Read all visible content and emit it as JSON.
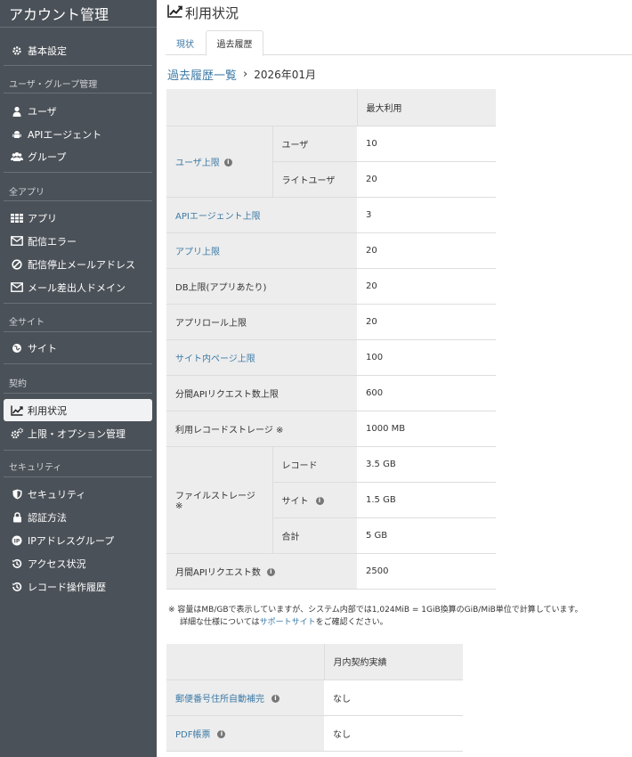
{
  "sidebar": {
    "title": "アカウント管理",
    "items": {
      "basic": "基本設定",
      "users": "ユーザ",
      "api_agents": "APIエージェント",
      "groups": "グループ",
      "apps": "アプリ",
      "delivery_error": "配信エラー",
      "delivery_stop": "配信停止メールアドレス",
      "sender_domain": "メール差出人ドメイン",
      "site": "サイト",
      "usage": "利用状況",
      "limits": "上限・オプション管理",
      "security": "セキュリティ",
      "auth": "認証方法",
      "ip_group": "IPアドレスグループ",
      "access": "アクセス状況",
      "record_log": "レコード操作履歴"
    },
    "sections": {
      "user_group": "ユーザ・グループ管理",
      "all_apps": "全アプリ",
      "all_sites": "全サイト",
      "contract": "契約",
      "security": "セキュリティ"
    }
  },
  "main": {
    "title": "利用状況",
    "tabs": {
      "current": "現状",
      "history": "過去履歴"
    },
    "breadcrumb": {
      "list": "過去履歴一覧",
      "sep": "›",
      "current": "2026年01月"
    }
  },
  "table1": {
    "header": "最大利用",
    "user_limit": "ユーザ上限",
    "user": "ユーザ",
    "user_val": "10",
    "light_user": "ライトユーザ",
    "light_user_val": "20",
    "api_agent_limit": "APIエージェント上限",
    "api_agent_val": "3",
    "app_limit": "アプリ上限",
    "app_val": "20",
    "db_limit": "DB上限(アプリあたり)",
    "db_val": "20",
    "app_role_limit": "アプリロール上限",
    "app_role_val": "20",
    "site_page_limit": "サイト内ページ上限",
    "site_page_val": "100",
    "api_per_min": "分間APIリクエスト数上限",
    "api_per_min_val": "600",
    "record_storage": "利用レコードストレージ ※",
    "record_storage_val": "1000 MB",
    "file_storage": "ファイルストレージ ※",
    "fs_record": "レコード",
    "fs_record_val": "3.5 GB",
    "fs_site": "サイト",
    "fs_site_val": "1.5 GB",
    "fs_total": "合計",
    "fs_total_val": "5 GB",
    "monthly_api": "月間APIリクエスト数",
    "monthly_api_val": "2500"
  },
  "note": {
    "line1": "※ 容量はMB/GBで表示していますが、システム内部では1,024MiB = 1GiB換算のGiB/MiB単位で計算しています。",
    "line2_pre": "詳細な仕様については",
    "line2_link": "サポートサイト",
    "line2_post": "をご確認ください。"
  },
  "table2": {
    "header": "月内契約実績",
    "postal": "郵便番号住所自動補完",
    "postal_val": "なし",
    "pdf": "PDF帳票",
    "pdf_val": "なし"
  },
  "colors": {
    "sidebar_bg": "#4b5158",
    "link": "#3d7aa6",
    "cell_bg": "#ededed"
  }
}
